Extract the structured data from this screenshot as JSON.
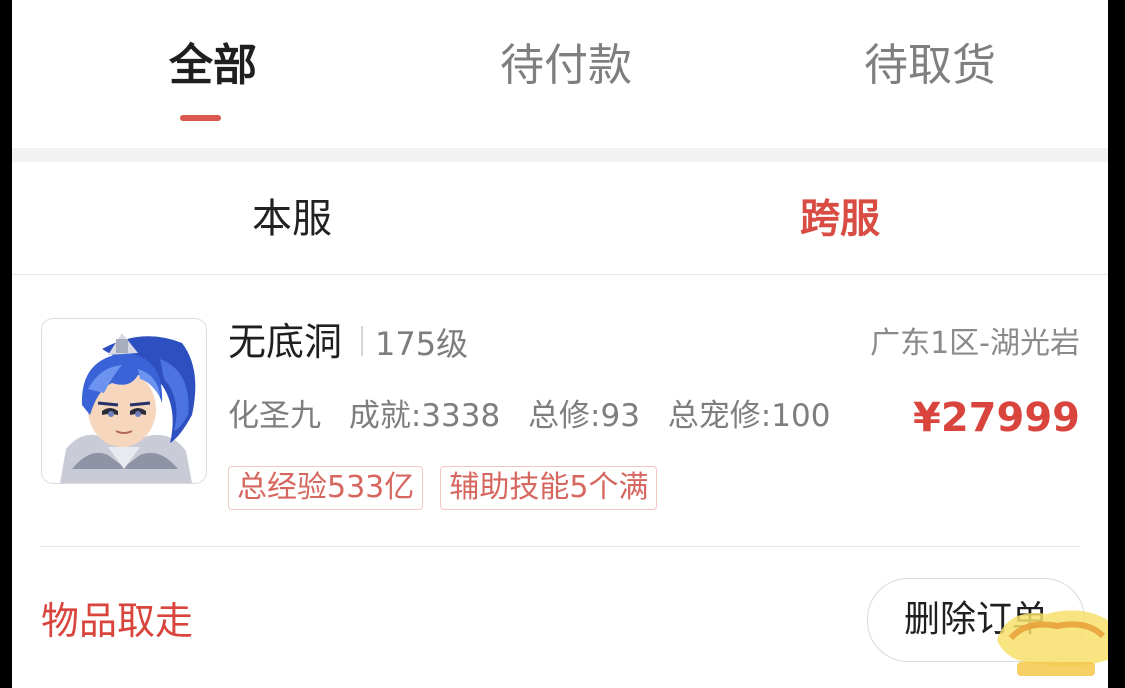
{
  "tabs": [
    {
      "label": "全部",
      "active": true
    },
    {
      "label": "待付款",
      "active": false
    },
    {
      "label": "待取货",
      "active": false
    }
  ],
  "subtabs": {
    "local": "本服",
    "cross": "跨服",
    "active": "cross"
  },
  "order": {
    "name": "无底洞",
    "level": "175级",
    "server": "广东1区-湖光岩",
    "stats": [
      "化圣九",
      "成就:3338",
      "总修:93",
      "总宠修:100"
    ],
    "price": "¥27999",
    "tags": [
      "总经验533亿",
      "辅助技能5个满"
    ],
    "status": "物品取走",
    "delete_label": "删除订单"
  },
  "avatar_icon": "blue-haired-hero-portrait",
  "colors": {
    "accent": "#d9453d",
    "tab_indicator": "#d95950",
    "tag_border": "#f2c7c4"
  }
}
